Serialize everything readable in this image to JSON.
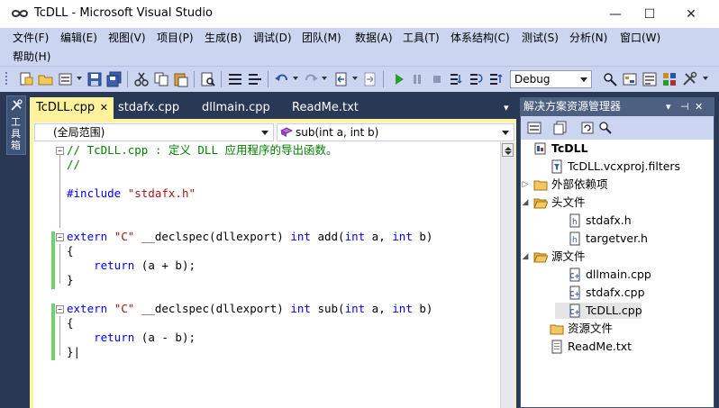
{
  "window": {
    "title": "TcDLL - Microsoft Visual Studio",
    "minimize_glyph": "—",
    "maximize_glyph": "☐",
    "close_glyph": "✕"
  },
  "menu": {
    "row1": [
      "文件(F)",
      "编辑(E)",
      "视图(V)",
      "项目(P)",
      "生成(B)",
      "调试(D)",
      "团队(M)",
      "数据(A)",
      "工具(T)",
      "体系结构(C)",
      "测试(S)",
      "分析(N)",
      "窗口(W)"
    ],
    "row2": [
      "帮助(H)"
    ]
  },
  "toolbar": {
    "configuration": "Debug"
  },
  "toolbox": {
    "label": "工具箱"
  },
  "tabs": {
    "active": "TcDLL.cpp",
    "close_glyph": "✕",
    "others": [
      "stdafx.cpp",
      "dllmain.cpp",
      "ReadMe.txt"
    ],
    "overflow_glyph": "▾"
  },
  "navbar": {
    "scope": "(全局范围)",
    "member": "sub(int a, int b)"
  },
  "code": {
    "lines": [
      {
        "parts": [
          {
            "t": "// TcDLL.cpp : 定义 DLL 应用程序的导出函数。",
            "c": "cm"
          }
        ]
      },
      {
        "parts": [
          {
            "t": "//",
            "c": "cm"
          }
        ]
      },
      {
        "parts": [
          {
            "t": "",
            "c": ""
          }
        ]
      },
      {
        "parts": [
          {
            "t": "#include ",
            "c": "pp"
          },
          {
            "t": "\"stdafx.h\"",
            "c": "st"
          }
        ]
      },
      {
        "parts": [
          {
            "t": "",
            "c": ""
          }
        ]
      },
      {
        "parts": [
          {
            "t": "",
            "c": ""
          }
        ]
      },
      {
        "parts": [
          {
            "t": "extern ",
            "c": "kw"
          },
          {
            "t": "\"C\"",
            "c": "st"
          },
          {
            "t": " __declspec(dllexport) ",
            "c": ""
          },
          {
            "t": "int",
            "c": "kw"
          },
          {
            "t": " add(",
            "c": ""
          },
          {
            "t": "int",
            "c": "kw"
          },
          {
            "t": " a, ",
            "c": ""
          },
          {
            "t": "int",
            "c": "kw"
          },
          {
            "t": " b)",
            "c": ""
          }
        ]
      },
      {
        "parts": [
          {
            "t": "{",
            "c": ""
          }
        ]
      },
      {
        "parts": [
          {
            "t": "    ",
            "c": ""
          },
          {
            "t": "return",
            "c": "kw"
          },
          {
            "t": " (a + b);",
            "c": ""
          }
        ]
      },
      {
        "parts": [
          {
            "t": "}",
            "c": ""
          }
        ]
      },
      {
        "parts": [
          {
            "t": "",
            "c": ""
          }
        ]
      },
      {
        "parts": [
          {
            "t": "extern ",
            "c": "kw"
          },
          {
            "t": "\"C\"",
            "c": "st"
          },
          {
            "t": " __declspec(dllexport) ",
            "c": ""
          },
          {
            "t": "int",
            "c": "kw"
          },
          {
            "t": " sub(",
            "c": ""
          },
          {
            "t": "int",
            "c": "kw"
          },
          {
            "t": " a, ",
            "c": ""
          },
          {
            "t": "int",
            "c": "kw"
          },
          {
            "t": " b)",
            "c": ""
          }
        ]
      },
      {
        "parts": [
          {
            "t": "{",
            "c": ""
          }
        ]
      },
      {
        "parts": [
          {
            "t": "    ",
            "c": ""
          },
          {
            "t": "return",
            "c": "kw"
          },
          {
            "t": " (a - b);",
            "c": ""
          }
        ]
      },
      {
        "parts": [
          {
            "t": "}|",
            "c": ""
          }
        ]
      }
    ]
  },
  "solution_explorer": {
    "title": "解决方案资源管理器",
    "pin_glyph": "▾",
    "autohide_glyph": "⊣",
    "close_glyph": "✕",
    "items": [
      {
        "label": "TcDLL",
        "icon": "project-icon",
        "expander": "",
        "bold": true
      },
      {
        "label": "TcDLL.vcxproj.filters",
        "icon": "filters-file-icon",
        "expander": ""
      },
      {
        "label": "外部依赖项",
        "icon": "folder-icon",
        "expander": "▷"
      },
      {
        "label": "头文件",
        "icon": "folder-open-icon",
        "expander": "◢"
      },
      {
        "label": "stdafx.h",
        "icon": "header-file-icon",
        "expander": ""
      },
      {
        "label": "targetver.h",
        "icon": "header-file-icon",
        "expander": ""
      },
      {
        "label": "源文件",
        "icon": "folder-open-icon",
        "expander": "◢"
      },
      {
        "label": "dllmain.cpp",
        "icon": "cpp-file-icon",
        "expander": ""
      },
      {
        "label": "stdafx.cpp",
        "icon": "cpp-file-icon",
        "expander": ""
      },
      {
        "label": "TcDLL.cpp",
        "icon": "cpp-file-icon",
        "expander": "",
        "selected": true
      },
      {
        "label": "资源文件",
        "icon": "folder-icon",
        "expander": ""
      },
      {
        "label": "ReadMe.txt",
        "icon": "text-file-icon",
        "expander": ""
      }
    ]
  },
  "colors": {
    "ide_background": "#293955",
    "menu_background": "#ccd5f0",
    "active_tab": "#fff29d",
    "panel_header": "#4d6082",
    "change_bar": "#6ed36e"
  }
}
